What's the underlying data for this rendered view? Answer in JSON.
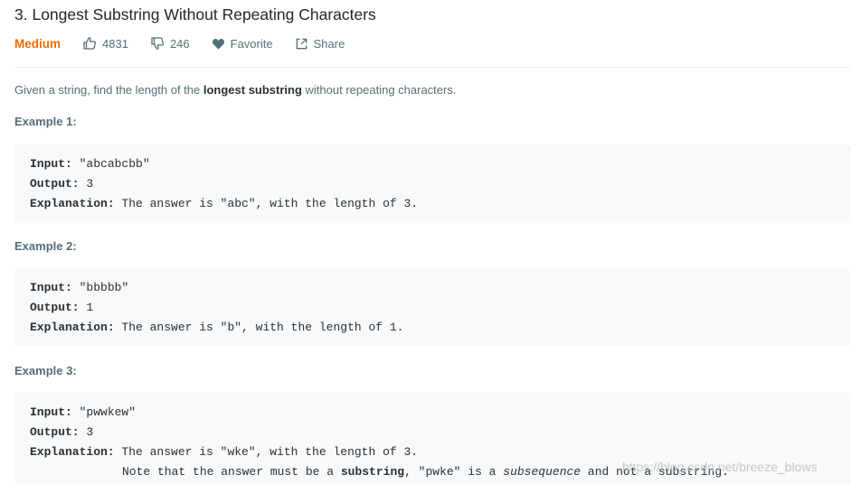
{
  "problem": {
    "title": "3. Longest Substring Without Repeating Characters",
    "difficulty": "Medium",
    "likes": "4831",
    "dislikes": "246",
    "favorite_label": "Favorite",
    "share_label": "Share",
    "difficulty_color": "#ef6c00"
  },
  "description": {
    "pre": "Given a string, find the length of the ",
    "bold": "longest substring",
    "post": " without repeating characters."
  },
  "examples": [
    {
      "title": "Example 1:",
      "input_label": "Input:",
      "input": " \"abcabcbb\"",
      "output_label": "Output:",
      "output": " 3",
      "explanation_label": "Explanation:",
      "explanation": " The answer is \"abc\", with the length of 3."
    },
    {
      "title": "Example 2:",
      "input_label": "Input:",
      "input": " \"bbbbb\"",
      "output_label": "Output:",
      "output": " 1",
      "explanation_label": "Explanation:",
      "explanation": " The answer is \"b\", with the length of 1."
    },
    {
      "title": "Example 3:",
      "input_label": "Input:",
      "input": " \"pwwkew\"",
      "output_label": "Output:",
      "output": " 3",
      "explanation_label": "Explanation:",
      "explanation": " The answer is \"wke\", with the length of 3.",
      "note_pre": "Note that the answer must be a ",
      "note_bold": "substring",
      "note_mid": ", \"pwke\" is a ",
      "note_italic": "subsequence",
      "note_post": " and not a substring."
    }
  ],
  "watermark": "https://blog.csdn.net/breeze_blows"
}
